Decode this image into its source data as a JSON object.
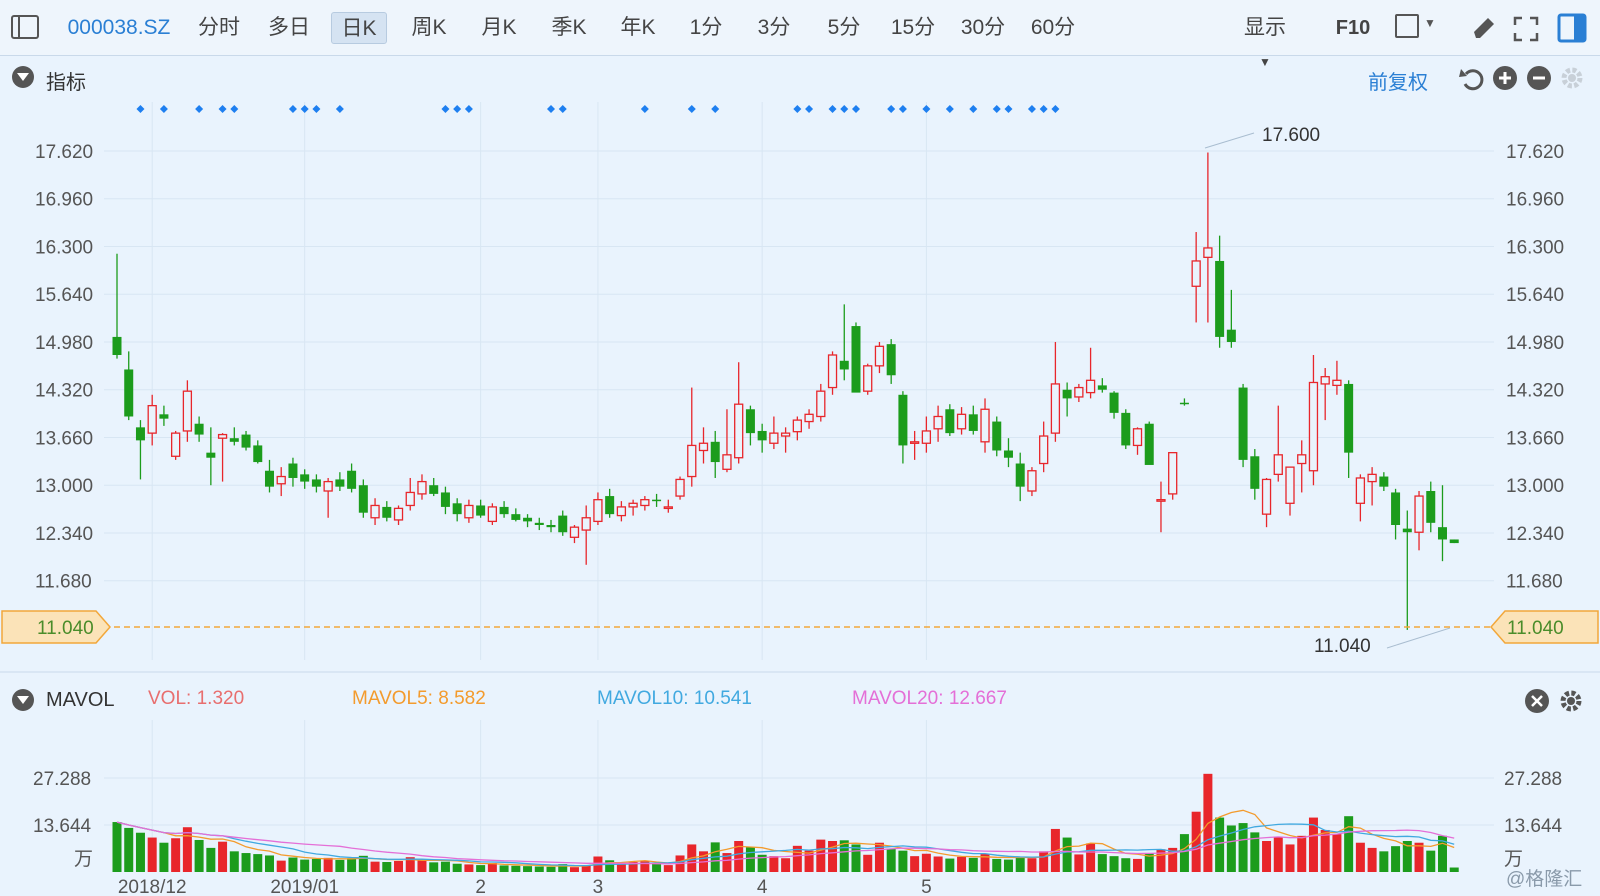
{
  "toolbar": {
    "code": "000038.SZ",
    "items": [
      "分时",
      "多日",
      "日K",
      "周K",
      "月K",
      "季K",
      "年K",
      "1分",
      "3分",
      "5分",
      "15分",
      "30分",
      "60分"
    ],
    "active": "日K",
    "display_label": "显示",
    "f10_label": "F10"
  },
  "main_panel": {
    "title": "指标",
    "adjust_label": "前复权",
    "high_label": "17.600",
    "low_label": "11.040",
    "price_line_label": "11.040"
  },
  "volume_panel": {
    "title": "MAVOL",
    "vol_label": "VOL:",
    "vol_value": "1.320",
    "ma5_label": "MAVOL5:",
    "ma5_value": "8.582",
    "ma10_label": "MAVOL10:",
    "ma10_value": "10.541",
    "ma20_label": "MAVOL20:",
    "ma20_value": "12.667",
    "unit": "万",
    "watermark": "@格隆汇"
  },
  "colors": {
    "up": "#e8262b",
    "down": "#1c9c1c",
    "ma5": "#f39b2d",
    "ma10": "#41a9e0",
    "ma20": "#e46fd7",
    "accent": "#2a7fd4"
  },
  "chart_data": {
    "type": "candlestick",
    "price_axis_ticks": [
      17.62,
      16.96,
      16.3,
      15.64,
      14.98,
      14.32,
      13.66,
      13.0,
      12.34,
      11.68,
      11.04
    ],
    "price_axis_labels": [
      "17.620",
      "16.960",
      "16.300",
      "15.640",
      "14.980",
      "14.320",
      "13.660",
      "13.000",
      "12.340",
      "11.680",
      "11.040"
    ],
    "price_range": [
      10.9,
      17.8
    ],
    "volume_axis_ticks": [
      27.288,
      13.644
    ],
    "volume_axis_labels": [
      "27.288",
      "13.644"
    ],
    "volume_range": [
      0,
      28.5
    ],
    "x_labels": [
      "2018/12",
      "2019/01",
      "2",
      "3",
      "4",
      "5"
    ],
    "x_label_index": [
      3,
      16,
      31,
      41,
      55,
      69
    ],
    "event_marker_index": [
      2,
      4,
      7,
      9,
      10,
      15,
      16,
      17,
      19,
      28,
      29,
      30,
      37,
      38,
      45,
      49,
      51,
      58,
      59,
      61,
      62,
      63,
      66,
      67,
      69,
      71,
      73,
      75,
      76,
      78,
      79,
      80
    ],
    "candles": [
      {
        "o": 15.05,
        "h": 16.2,
        "l": 14.75,
        "c": 14.8,
        "v": 14.5
      },
      {
        "o": 14.6,
        "h": 14.85,
        "l": 13.9,
        "c": 13.95,
        "v": 12.8
      },
      {
        "o": 13.8,
        "h": 13.9,
        "l": 13.08,
        "c": 13.62,
        "v": 11.4
      },
      {
        "o": 13.72,
        "h": 14.25,
        "l": 13.55,
        "c": 14.1,
        "v": 10.0
      },
      {
        "o": 13.98,
        "h": 14.1,
        "l": 13.82,
        "c": 13.92,
        "v": 8.5
      },
      {
        "o": 13.4,
        "h": 13.75,
        "l": 13.35,
        "c": 13.72,
        "v": 9.8
      },
      {
        "o": 13.75,
        "h": 14.45,
        "l": 13.6,
        "c": 14.3,
        "v": 13.0
      },
      {
        "o": 13.85,
        "h": 13.95,
        "l": 13.6,
        "c": 13.7,
        "v": 9.3
      },
      {
        "o": 13.45,
        "h": 13.8,
        "l": 13.0,
        "c": 13.38,
        "v": 7.0
      },
      {
        "o": 13.65,
        "h": 13.72,
        "l": 13.05,
        "c": 13.7,
        "v": 8.8
      },
      {
        "o": 13.65,
        "h": 13.8,
        "l": 13.55,
        "c": 13.6,
        "v": 6.0
      },
      {
        "o": 13.7,
        "h": 13.75,
        "l": 13.48,
        "c": 13.52,
        "v": 5.5
      },
      {
        "o": 13.55,
        "h": 13.62,
        "l": 13.3,
        "c": 13.32,
        "v": 5.2
      },
      {
        "o": 13.2,
        "h": 13.35,
        "l": 12.9,
        "c": 12.98,
        "v": 4.8
      },
      {
        "o": 13.02,
        "h": 13.25,
        "l": 12.85,
        "c": 13.12,
        "v": 3.3
      },
      {
        "o": 13.3,
        "h": 13.38,
        "l": 12.98,
        "c": 13.1,
        "v": 4.2
      },
      {
        "o": 13.15,
        "h": 13.22,
        "l": 12.95,
        "c": 13.05,
        "v": 3.6
      },
      {
        "o": 13.08,
        "h": 13.15,
        "l": 12.9,
        "c": 12.98,
        "v": 3.8
      },
      {
        "o": 12.92,
        "h": 13.1,
        "l": 12.55,
        "c": 13.05,
        "v": 4.1
      },
      {
        "o": 13.08,
        "h": 13.18,
        "l": 12.92,
        "c": 12.98,
        "v": 3.5
      },
      {
        "o": 13.2,
        "h": 13.3,
        "l": 12.9,
        "c": 12.95,
        "v": 4.0
      },
      {
        "o": 13.0,
        "h": 13.08,
        "l": 12.55,
        "c": 12.62,
        "v": 4.7
      },
      {
        "o": 12.55,
        "h": 12.82,
        "l": 12.45,
        "c": 12.72,
        "v": 3.0
      },
      {
        "o": 12.7,
        "h": 12.78,
        "l": 12.5,
        "c": 12.55,
        "v": 2.9
      },
      {
        "o": 12.52,
        "h": 12.72,
        "l": 12.45,
        "c": 12.68,
        "v": 3.2
      },
      {
        "o": 12.72,
        "h": 13.1,
        "l": 12.65,
        "c": 12.9,
        "v": 4.3
      },
      {
        "o": 12.88,
        "h": 13.15,
        "l": 12.8,
        "c": 13.05,
        "v": 3.6
      },
      {
        "o": 13.0,
        "h": 13.1,
        "l": 12.85,
        "c": 12.88,
        "v": 2.8
      },
      {
        "o": 12.9,
        "h": 12.98,
        "l": 12.6,
        "c": 12.7,
        "v": 3.0
      },
      {
        "o": 12.75,
        "h": 12.82,
        "l": 12.5,
        "c": 12.6,
        "v": 2.4
      },
      {
        "o": 12.55,
        "h": 12.8,
        "l": 12.48,
        "c": 12.72,
        "v": 2.2
      },
      {
        "o": 12.72,
        "h": 12.8,
        "l": 12.55,
        "c": 12.58,
        "v": 2.0
      },
      {
        "o": 12.5,
        "h": 12.75,
        "l": 12.45,
        "c": 12.7,
        "v": 2.6
      },
      {
        "o": 12.7,
        "h": 12.78,
        "l": 12.55,
        "c": 12.6,
        "v": 1.9
      },
      {
        "o": 12.6,
        "h": 12.68,
        "l": 12.5,
        "c": 12.52,
        "v": 1.8
      },
      {
        "o": 12.55,
        "h": 12.6,
        "l": 12.42,
        "c": 12.5,
        "v": 1.7
      },
      {
        "o": 12.48,
        "h": 12.55,
        "l": 12.38,
        "c": 12.45,
        "v": 1.6
      },
      {
        "o": 12.45,
        "h": 12.52,
        "l": 12.35,
        "c": 12.42,
        "v": 1.5
      },
      {
        "o": 12.58,
        "h": 12.65,
        "l": 12.3,
        "c": 12.35,
        "v": 2.3
      },
      {
        "o": 12.28,
        "h": 12.45,
        "l": 12.2,
        "c": 12.42,
        "v": 1.4
      },
      {
        "o": 12.38,
        "h": 12.72,
        "l": 11.9,
        "c": 12.55,
        "v": 1.9
      },
      {
        "o": 12.5,
        "h": 12.9,
        "l": 12.45,
        "c": 12.8,
        "v": 4.5
      },
      {
        "o": 12.85,
        "h": 12.95,
        "l": 12.55,
        "c": 12.6,
        "v": 3.4
      },
      {
        "o": 12.58,
        "h": 12.78,
        "l": 12.5,
        "c": 12.7,
        "v": 2.6
      },
      {
        "o": 12.7,
        "h": 12.8,
        "l": 12.58,
        "c": 12.75,
        "v": 2.9
      },
      {
        "o": 12.72,
        "h": 12.85,
        "l": 12.65,
        "c": 12.8,
        "v": 3.1
      },
      {
        "o": 12.8,
        "h": 12.88,
        "l": 12.7,
        "c": 12.78,
        "v": 2.5
      },
      {
        "o": 12.68,
        "h": 12.8,
        "l": 12.62,
        "c": 12.7,
        "v": 2.0
      },
      {
        "o": 12.85,
        "h": 13.12,
        "l": 12.8,
        "c": 13.08,
        "v": 4.8
      },
      {
        "o": 13.12,
        "h": 14.35,
        "l": 12.98,
        "c": 13.55,
        "v": 8.0
      },
      {
        "o": 13.48,
        "h": 13.8,
        "l": 13.3,
        "c": 13.58,
        "v": 6.0
      },
      {
        "o": 13.6,
        "h": 13.75,
        "l": 13.1,
        "c": 13.32,
        "v": 8.6
      },
      {
        "o": 13.22,
        "h": 14.05,
        "l": 13.18,
        "c": 13.42,
        "v": 5.5
      },
      {
        "o": 13.38,
        "h": 14.7,
        "l": 13.3,
        "c": 14.12,
        "v": 9.0
      },
      {
        "o": 14.05,
        "h": 14.1,
        "l": 13.55,
        "c": 13.72,
        "v": 7.2
      },
      {
        "o": 13.75,
        "h": 13.85,
        "l": 13.45,
        "c": 13.62,
        "v": 5.0
      },
      {
        "o": 13.58,
        "h": 13.95,
        "l": 13.5,
        "c": 13.72,
        "v": 4.6
      },
      {
        "o": 13.68,
        "h": 13.8,
        "l": 13.45,
        "c": 13.72,
        "v": 4.0
      },
      {
        "o": 13.74,
        "h": 13.95,
        "l": 13.62,
        "c": 13.9,
        "v": 7.6
      },
      {
        "o": 13.88,
        "h": 14.05,
        "l": 13.78,
        "c": 13.98,
        "v": 6.2
      },
      {
        "o": 13.95,
        "h": 14.4,
        "l": 13.88,
        "c": 14.3,
        "v": 9.4
      },
      {
        "o": 14.35,
        "h": 14.85,
        "l": 14.25,
        "c": 14.8,
        "v": 9.0
      },
      {
        "o": 14.72,
        "h": 15.5,
        "l": 14.45,
        "c": 14.6,
        "v": 9.2
      },
      {
        "o": 15.2,
        "h": 15.25,
        "l": 14.32,
        "c": 14.28,
        "v": 8.0
      },
      {
        "o": 14.3,
        "h": 14.68,
        "l": 14.25,
        "c": 14.65,
        "v": 5.0
      },
      {
        "o": 14.65,
        "h": 14.98,
        "l": 14.55,
        "c": 14.92,
        "v": 8.5
      },
      {
        "o": 14.95,
        "h": 15.02,
        "l": 14.4,
        "c": 14.52,
        "v": 6.8
      },
      {
        "o": 14.25,
        "h": 14.3,
        "l": 13.3,
        "c": 13.55,
        "v": 6.2
      },
      {
        "o": 13.58,
        "h": 13.75,
        "l": 13.35,
        "c": 13.6,
        "v": 4.6
      },
      {
        "o": 13.58,
        "h": 13.95,
        "l": 13.45,
        "c": 13.75,
        "v": 5.3
      },
      {
        "o": 13.78,
        "h": 14.1,
        "l": 13.6,
        "c": 13.95,
        "v": 4.5
      },
      {
        "o": 14.05,
        "h": 14.12,
        "l": 13.68,
        "c": 13.72,
        "v": 3.9
      },
      {
        "o": 13.78,
        "h": 14.08,
        "l": 13.7,
        "c": 13.98,
        "v": 4.4
      },
      {
        "o": 13.98,
        "h": 14.1,
        "l": 13.7,
        "c": 13.75,
        "v": 4.1
      },
      {
        "o": 13.6,
        "h": 14.2,
        "l": 13.45,
        "c": 14.05,
        "v": 5.2
      },
      {
        "o": 13.88,
        "h": 13.95,
        "l": 13.4,
        "c": 13.48,
        "v": 3.8
      },
      {
        "o": 13.48,
        "h": 13.65,
        "l": 13.25,
        "c": 13.38,
        "v": 3.6
      },
      {
        "o": 13.3,
        "h": 13.45,
        "l": 12.78,
        "c": 12.98,
        "v": 4.4
      },
      {
        "o": 12.92,
        "h": 13.25,
        "l": 12.85,
        "c": 13.2,
        "v": 4.0
      },
      {
        "o": 13.3,
        "h": 13.88,
        "l": 13.18,
        "c": 13.68,
        "v": 6.0
      },
      {
        "o": 13.72,
        "h": 14.98,
        "l": 13.6,
        "c": 14.4,
        "v": 12.5
      },
      {
        "o": 14.32,
        "h": 14.42,
        "l": 13.95,
        "c": 14.2,
        "v": 10.0
      },
      {
        "o": 14.22,
        "h": 14.4,
        "l": 14.15,
        "c": 14.35,
        "v": 5.1
      },
      {
        "o": 14.28,
        "h": 14.9,
        "l": 14.2,
        "c": 14.45,
        "v": 8.3
      },
      {
        "o": 14.38,
        "h": 14.48,
        "l": 14.28,
        "c": 14.32,
        "v": 5.2
      },
      {
        "o": 14.28,
        "h": 14.3,
        "l": 13.92,
        "c": 14.0,
        "v": 4.6
      },
      {
        "o": 14.0,
        "h": 14.05,
        "l": 13.5,
        "c": 13.55,
        "v": 4.0
      },
      {
        "o": 13.55,
        "h": 13.8,
        "l": 13.42,
        "c": 13.78,
        "v": 3.8
      },
      {
        "o": 13.85,
        "h": 13.88,
        "l": 13.3,
        "c": 13.28,
        "v": 5.5
      },
      {
        "o": 12.8,
        "h": 13.05,
        "l": 12.35,
        "c": 12.8,
        "v": 6.6
      },
      {
        "o": 12.88,
        "h": 13.45,
        "l": 12.8,
        "c": 13.45,
        "v": 7.0
      },
      {
        "o": 14.14,
        "h": 14.2,
        "l": 14.1,
        "c": 14.12,
        "v": 11.0
      },
      {
        "o": 15.75,
        "h": 16.5,
        "l": 15.25,
        "c": 16.1,
        "v": 17.5
      },
      {
        "o": 16.15,
        "h": 17.6,
        "l": 15.25,
        "c": 16.28,
        "v": 28.5
      },
      {
        "o": 16.1,
        "h": 16.45,
        "l": 14.9,
        "c": 15.05,
        "v": 15.8
      },
      {
        "o": 15.15,
        "h": 15.7,
        "l": 14.9,
        "c": 14.98,
        "v": 13.5
      },
      {
        "o": 14.35,
        "h": 14.4,
        "l": 13.25,
        "c": 13.35,
        "v": 14.2
      },
      {
        "o": 13.4,
        "h": 13.5,
        "l": 12.8,
        "c": 12.95,
        "v": 11.5
      },
      {
        "o": 12.6,
        "h": 13.1,
        "l": 12.42,
        "c": 13.08,
        "v": 9.0
      },
      {
        "o": 13.15,
        "h": 14.1,
        "l": 13.05,
        "c": 13.42,
        "v": 10.3
      },
      {
        "o": 12.75,
        "h": 13.2,
        "l": 12.58,
        "c": 13.25,
        "v": 8.0
      },
      {
        "o": 13.3,
        "h": 13.62,
        "l": 12.9,
        "c": 13.42,
        "v": 10.5
      },
      {
        "o": 13.2,
        "h": 14.8,
        "l": 13.0,
        "c": 14.42,
        "v": 15.8
      },
      {
        "o": 14.4,
        "h": 14.62,
        "l": 13.9,
        "c": 14.5,
        "v": 12.2
      },
      {
        "o": 14.38,
        "h": 14.72,
        "l": 14.25,
        "c": 14.45,
        "v": 11.0
      },
      {
        "o": 14.4,
        "h": 14.45,
        "l": 13.1,
        "c": 13.45,
        "v": 16.2
      },
      {
        "o": 12.75,
        "h": 13.15,
        "l": 12.5,
        "c": 13.1,
        "v": 8.5
      },
      {
        "o": 13.05,
        "h": 13.25,
        "l": 12.72,
        "c": 13.15,
        "v": 7.0
      },
      {
        "o": 13.12,
        "h": 13.18,
        "l": 12.92,
        "c": 12.98,
        "v": 6.0
      },
      {
        "o": 12.9,
        "h": 12.95,
        "l": 12.25,
        "c": 12.45,
        "v": 7.5
      },
      {
        "o": 12.4,
        "h": 12.65,
        "l": 11.0,
        "c": 12.35,
        "v": 9.0
      },
      {
        "o": 12.35,
        "h": 12.92,
        "l": 12.1,
        "c": 12.85,
        "v": 8.5
      },
      {
        "o": 12.92,
        "h": 13.05,
        "l": 12.35,
        "c": 12.48,
        "v": 6.2
      },
      {
        "o": 12.42,
        "h": 13.0,
        "l": 11.95,
        "c": 12.25,
        "v": 10.5
      },
      {
        "o": 12.25,
        "h": 12.25,
        "l": 12.2,
        "c": 12.2,
        "v": 1.3
      }
    ]
  }
}
